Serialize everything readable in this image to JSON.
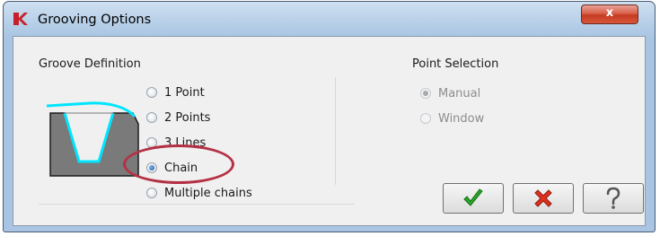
{
  "window": {
    "title": "Grooving Options",
    "close_label": "x"
  },
  "groove_definition": {
    "label": "Groove Definition",
    "options": [
      {
        "label": "1 Point",
        "checked": false,
        "enabled": true
      },
      {
        "label": "2 Points",
        "checked": false,
        "enabled": true
      },
      {
        "label": "3 Lines",
        "checked": false,
        "enabled": true
      },
      {
        "label": "Chain",
        "checked": true,
        "enabled": true
      },
      {
        "label": "Multiple chains",
        "checked": false,
        "enabled": true
      }
    ]
  },
  "point_selection": {
    "label": "Point Selection",
    "options": [
      {
        "label": "Manual",
        "checked": true,
        "enabled": false
      },
      {
        "label": "Window",
        "checked": false,
        "enabled": false
      }
    ]
  },
  "buttons": {
    "ok_icon": "checkmark-icon",
    "cancel_icon": "red-x-icon",
    "help_icon": "question-mark-icon"
  },
  "colors": {
    "highlight_ring": "#b43145",
    "groove_profile": "#00e5ff",
    "ok_green": "#2aa52a",
    "cancel_red": "#e0301e"
  }
}
